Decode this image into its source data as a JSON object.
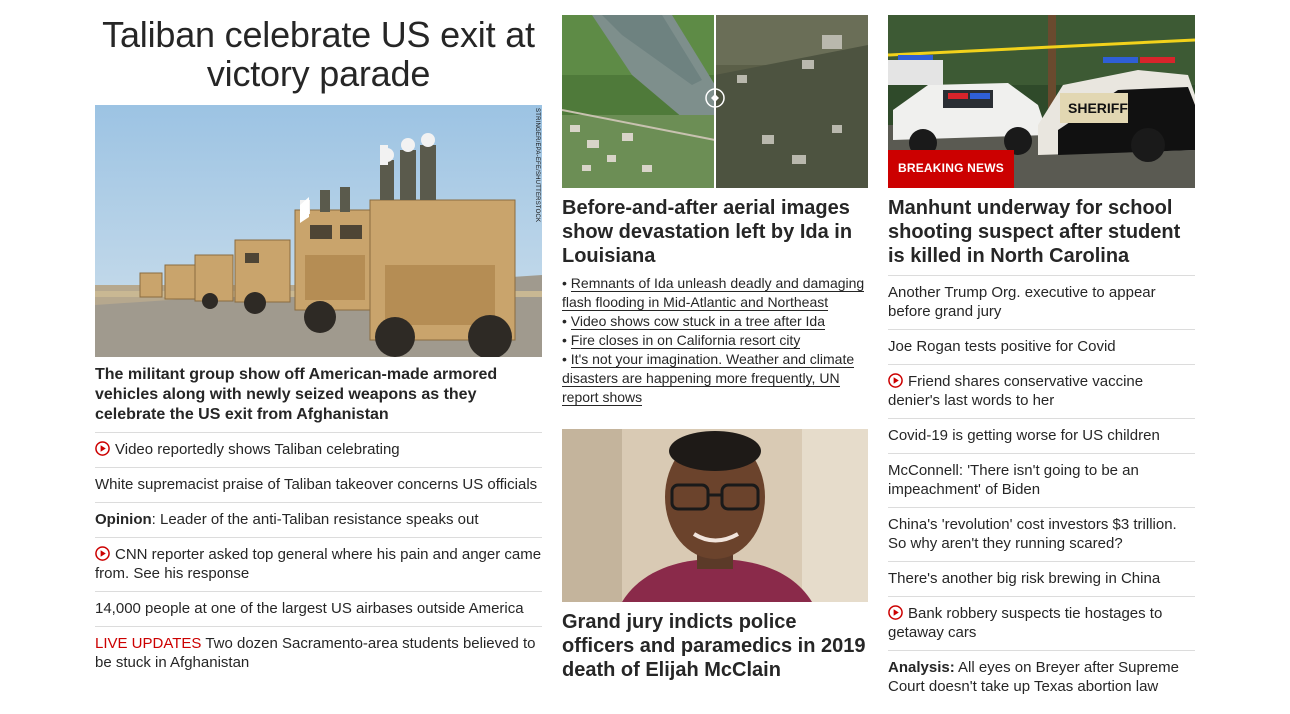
{
  "lead": {
    "title": "Taliban celebrate US exit at victory parade",
    "image_credit": "STRINGER/EPA-EFE/SHUTTERSTOCK",
    "summary": "The militant group show off American-made armored vehicles along with newly seized weapons as they celebrate the US exit from Afghanistan",
    "related": [
      {
        "video": true,
        "text": "Video reportedly shows Taliban celebrating"
      },
      {
        "text": "White supremacist praise of Taliban takeover concerns US officials"
      },
      {
        "prefix": "Opinion",
        "text": ": Leader of the anti-Taliban resistance speaks out"
      },
      {
        "video": true,
        "text": "CNN reporter asked top general where his pain and anger came from. See his response"
      },
      {
        "text": "14,000 people at one of the largest US airbases outside America"
      },
      {
        "live_label": "LIVE UPDATES",
        "text": " Two dozen Sacramento-area students believed to be stuck in Afghanistan"
      }
    ]
  },
  "ida": {
    "headline": "Before-and-after aerial images show devastation left by Ida in Louisiana",
    "bullets": [
      "Remnants of Ida unleash deadly and damaging flash flooding in Mid-Atlantic and Northeast",
      "Video shows cow stuck in a tree after Ida",
      "Fire closes in on California resort city",
      "It's not your imagination. Weather and climate disasters are happening more frequently, UN report shows"
    ]
  },
  "elijah": {
    "headline": "Grand jury indicts police officers and paramedics in 2019 death of Elijah McClain"
  },
  "manhunt": {
    "badge": "BREAKING NEWS",
    "sheriff_text": "SHERIFF",
    "headline": "Manhunt underway for school shooting suspect after student is killed in North Carolina",
    "related": [
      {
        "text": "Another Trump Org. executive to appear before grand jury"
      },
      {
        "text": "Joe Rogan tests positive for Covid"
      },
      {
        "video": true,
        "text": "Friend shares conservative vaccine denier's last words to her"
      },
      {
        "text": "Covid-19 is getting worse for US children"
      },
      {
        "text": "McConnell: 'There isn't going to be an impeachment' of Biden"
      },
      {
        "text": "China's 'revolution' cost investors $3 trillion. So why aren't they running scared?"
      },
      {
        "text": "There's another big risk brewing in China"
      },
      {
        "video": true,
        "text": "Bank robbery suspects tie hostages to getaway cars"
      },
      {
        "prefix": "Analysis:",
        "text": " All eyes on Breyer after Supreme Court doesn't take up Texas abortion law"
      }
    ]
  },
  "colors": {
    "accent_red": "#cc0000",
    "text": "#262626",
    "divider": "#dcdcdc"
  },
  "icons": {
    "video": "play-circle-icon"
  }
}
